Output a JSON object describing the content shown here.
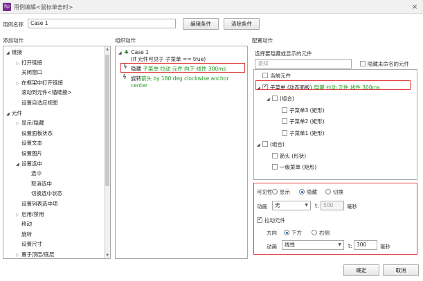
{
  "window": {
    "title": "用例编辑<鼠标单击时>",
    "app_icon": "Rp",
    "close_glyph": "×"
  },
  "case": {
    "label": "用例名称",
    "value": "Case 1"
  },
  "toolbar": {
    "edit_condition": "编辑条件",
    "clear_condition": "清除条件"
  },
  "sections": {
    "add_action": "添加动作",
    "organize_action": "组织动作",
    "configure_action": "配置动作"
  },
  "add_actions": [
    {
      "label": "链接",
      "level": 0,
      "tri": "expanded"
    },
    {
      "label": "打开链接",
      "level": 1,
      "tri": "collapsed"
    },
    {
      "label": "关闭窗口",
      "level": 1,
      "tri": "none"
    },
    {
      "label": "在框架中打开链接",
      "level": 1,
      "tri": "collapsed"
    },
    {
      "label": "滚动到元件<锚链接>",
      "level": 1,
      "tri": "none"
    },
    {
      "label": "设置自适应视图",
      "level": 1,
      "tri": "none"
    },
    {
      "label": "元件",
      "level": 0,
      "tri": "expanded"
    },
    {
      "label": "显示/隐藏",
      "level": 1,
      "tri": "collapsed"
    },
    {
      "label": "设置面板状态",
      "level": 1,
      "tri": "none"
    },
    {
      "label": "设置文本",
      "level": 1,
      "tri": "none"
    },
    {
      "label": "设置图片",
      "level": 1,
      "tri": "none"
    },
    {
      "label": "设置选中",
      "level": 1,
      "tri": "expanded"
    },
    {
      "label": "选中",
      "level": 2,
      "tri": "none"
    },
    {
      "label": "取消选中",
      "level": 2,
      "tri": "none"
    },
    {
      "label": "切换选中状态",
      "level": 2,
      "tri": "none"
    },
    {
      "label": "设置列表选中项",
      "level": 1,
      "tri": "none"
    },
    {
      "label": "启用/禁用",
      "level": 1,
      "tri": "collapsed"
    },
    {
      "label": "移动",
      "level": 1,
      "tri": "none"
    },
    {
      "label": "旋转",
      "level": 1,
      "tri": "none"
    },
    {
      "label": "设置尺寸",
      "level": 1,
      "tri": "none"
    },
    {
      "label": "置于顶层/底层",
      "level": 1,
      "tri": "collapsed"
    }
  ],
  "organize": {
    "case_name": "Case 1",
    "condition": "(If 元件可见于 子菜单 == true)",
    "action1": {
      "verb": "隐藏",
      "detail": "子菜单 拉动 元件 向下 线性 300ms"
    },
    "action2": {
      "verb": "旋转",
      "detail": "箭头 by 180 deg clockwise anchor center"
    }
  },
  "configure": {
    "select_label": "选择要隐藏或显示的元件",
    "search_placeholder": "查找",
    "hide_unnamed": "隐藏未命名的元件",
    "widgets": [
      {
        "label": "当前元件",
        "detail": "",
        "level": 0,
        "tri": "none",
        "checked": false
      },
      {
        "label": "子菜单 (动态面板)",
        "detail": "隐藏 拉动 元件 线性 300ms",
        "level": 0,
        "tri": "expanded",
        "checked": true
      },
      {
        "label": "(组合)",
        "detail": "",
        "level": 1,
        "tri": "expanded",
        "checked": false
      },
      {
        "label": "子菜单3 (矩形)",
        "detail": "",
        "level": 2,
        "tri": "none",
        "checked": false
      },
      {
        "label": "子菜单2 (矩形)",
        "detail": "",
        "level": 2,
        "tri": "none",
        "checked": false
      },
      {
        "label": "子菜单1 (矩形)",
        "detail": "",
        "level": 2,
        "tri": "none",
        "checked": false
      },
      {
        "label": "(组合)",
        "detail": "",
        "level": 0,
        "tri": "expanded",
        "checked": false
      },
      {
        "label": "箭头 (形状)",
        "detail": "",
        "level": 1,
        "tri": "none",
        "checked": false
      },
      {
        "label": "一级菜单 (矩形)",
        "detail": "",
        "level": 1,
        "tri": "none",
        "checked": false
      }
    ],
    "visibility_label": "可见性",
    "vis_show": "显示",
    "vis_hide": "隐藏",
    "vis_toggle": "切换",
    "anim_label": "动画",
    "anim_value": "无",
    "t_label": "t:",
    "t_value": "500",
    "ms": "毫秒",
    "pull_label": "拉动元件",
    "dir_label": "方向",
    "dir_down": "下方",
    "dir_right": "右侧",
    "anim2_label": "动画",
    "anim2_value": "线性",
    "t2_label": "t:",
    "t2_value": "300",
    "ms2": "毫秒"
  },
  "footer": {
    "ok": "确定",
    "cancel": "取消"
  }
}
